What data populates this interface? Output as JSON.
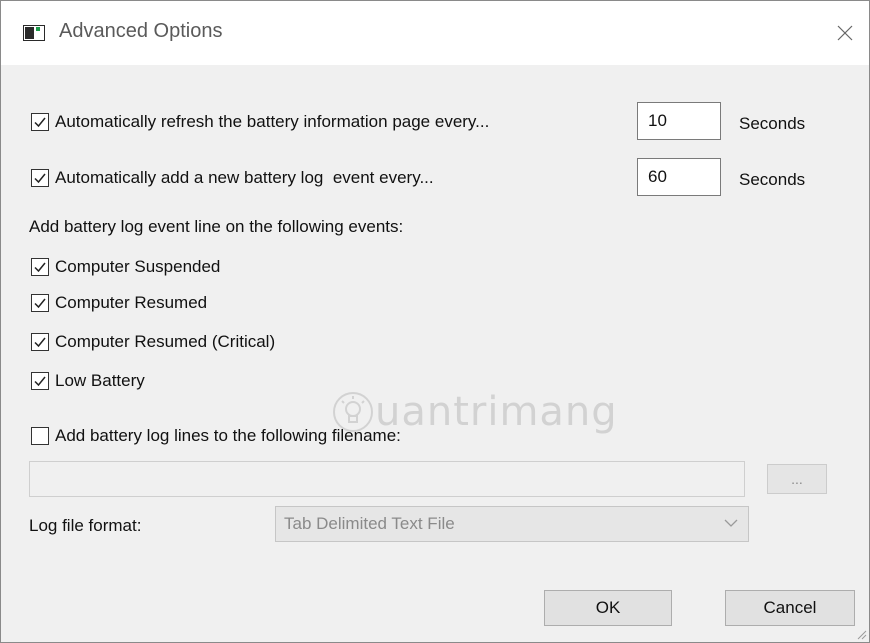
{
  "window": {
    "title": "Advanced Options"
  },
  "refresh": {
    "label": "Automatically refresh the battery information page every...",
    "checked": true,
    "value": "10",
    "unit": "Seconds"
  },
  "log_event": {
    "label": "Automatically add a new battery log  event every...",
    "checked": true,
    "value": "60",
    "unit": "Seconds"
  },
  "events_heading": "Add battery log event line on the following events:",
  "events": [
    {
      "label": "Computer Suspended",
      "checked": true
    },
    {
      "label": "Computer Resumed",
      "checked": true
    },
    {
      "label": "Computer Resumed (Critical)",
      "checked": true
    },
    {
      "label": "Low Battery",
      "checked": true
    }
  ],
  "file_option": {
    "label": "Add battery log lines to the following filename:",
    "checked": false,
    "value": ""
  },
  "browse": {
    "label": "..."
  },
  "log_format": {
    "label": "Log file format:",
    "selected": "Tab Delimited Text File"
  },
  "buttons": {
    "ok": "OK",
    "cancel": "Cancel"
  },
  "watermark": {
    "text": "uantrimang",
    "icon": "lightbulb-icon"
  },
  "colors": {
    "check": "#222222",
    "disabled_text": "#8a8a8a",
    "title_text": "#5a5a5a"
  }
}
